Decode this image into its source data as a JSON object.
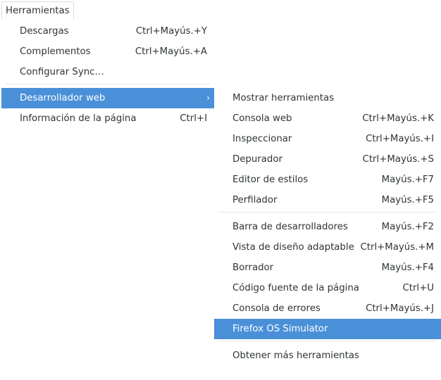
{
  "menubar": {
    "tools_label": "Herramientas"
  },
  "main_menu": {
    "items": [
      {
        "label": "Descargas",
        "accel": "Ctrl+Mayús.+Y"
      },
      {
        "label": "Complementos",
        "accel": "Ctrl+Mayús.+A"
      },
      {
        "label": "Configurar Sync…",
        "accel": ""
      },
      {
        "label": "Desarrollador web",
        "accel": "",
        "submenu_arrow": "›"
      },
      {
        "label": "Información de la página",
        "accel": "Ctrl+I"
      }
    ]
  },
  "sub_menu": {
    "items": [
      {
        "label": "Mostrar herramientas",
        "accel": ""
      },
      {
        "label": "Consola web",
        "accel": "Ctrl+Mayús.+K"
      },
      {
        "label": "Inspeccionar",
        "accel": "Ctrl+Mayús.+I"
      },
      {
        "label": "Depurador",
        "accel": "Ctrl+Mayús.+S"
      },
      {
        "label": "Editor de estilos",
        "accel": "Mayús.+F7"
      },
      {
        "label": "Perfilador",
        "accel": "Mayús.+F5"
      },
      {
        "label": "Barra de desarrolladores",
        "accel": "Mayús.+F2"
      },
      {
        "label": "Vista de diseño adaptable",
        "accel": "Ctrl+Mayús.+M"
      },
      {
        "label": "Borrador",
        "accel": "Mayús.+F4"
      },
      {
        "label": "Código fuente de la página",
        "accel": "Ctrl+U"
      },
      {
        "label": "Consola de errores",
        "accel": "Ctrl+Mayús.+J"
      },
      {
        "label": "Firefox OS Simulator",
        "accel": ""
      },
      {
        "label": "Obtener más herramientas",
        "accel": ""
      }
    ]
  },
  "colors": {
    "highlight": "#4a90d9",
    "text": "#2e3436",
    "separator": "#e6e6e6"
  }
}
